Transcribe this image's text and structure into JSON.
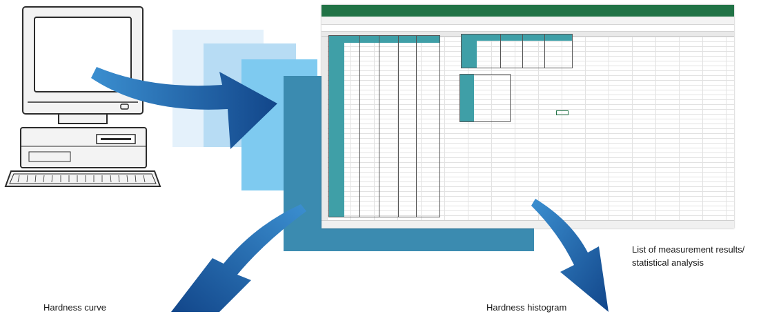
{
  "labels": {
    "list_line1": "List of measurement results/",
    "list_line2": "statistical analysis",
    "hardness_curve": "Hardness curve",
    "hardness_histogram": "Hardness histogram"
  },
  "icons": {
    "computer": "computer-icon",
    "arrow_to_sheet": "arrow-right-icon",
    "arrow_to_curve": "arrow-down-left-icon",
    "arrow_to_histogram": "arrow-down-right-icon",
    "spreadsheet": "spreadsheet-icon"
  },
  "colors": {
    "arrow": "#1d69b0",
    "arrow_dark": "#0f3f78",
    "layer1": "#e4f1fb",
    "layer2": "#b7dcf4",
    "layer3": "#7ecaf0",
    "layer4": "#3b8bb0",
    "excel_green": "#217346",
    "table_header": "#3f9fa7"
  }
}
